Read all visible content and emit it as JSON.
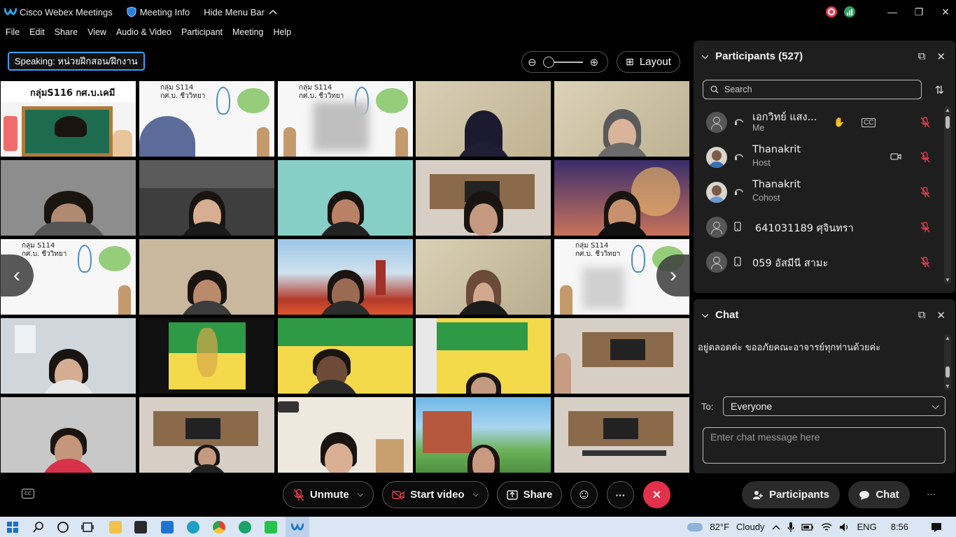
{
  "titlebar": {
    "app_name": "Cisco Webex Meetings",
    "meeting_info": "Meeting Info",
    "hide_menu": "Hide Menu Bar",
    "chevron_up": "^",
    "minimize": "—",
    "restore": "❐",
    "close": "✕"
  },
  "menu": {
    "items": [
      "File",
      "Edit",
      "Share",
      "View",
      "Audio & Video",
      "Participant",
      "Meeting",
      "Help"
    ]
  },
  "toolbar": {
    "speaking": "Speaking: หน่วยฝึกสอน/ฝึกงาน",
    "zoom_out": "⊖",
    "zoom_in": "⊕",
    "zoom_level": 0.05,
    "layout_icon": "⊞",
    "layout_label": "Layout"
  },
  "grid": {
    "tile1_title": "กลุ่มS116 กศ.บ.เคมี",
    "tile_s114_title": "กลุ่ม S114",
    "tile_s114_sub": "กศ.บ. ชีววิทยา",
    "prev_arrow": "‹",
    "next_arrow": "›"
  },
  "participants": {
    "chevron": "⌵",
    "title": "Participants (527)",
    "popout_icon": "⧉",
    "close_icon": "✕",
    "search_placeholder": "Search",
    "sort_icon": "⇅",
    "rows": [
      {
        "name": "เอกวิทย์ แสง...",
        "role": "Me"
      },
      {
        "name": "Thanakrit",
        "role": "Host"
      },
      {
        "name": "Thanakrit",
        "role": "Cohost"
      },
      {
        "name": "641031189 ศุจินทรา",
        "role": ""
      },
      {
        "name": "059 อัสมีนี สามะ",
        "role": ""
      }
    ]
  },
  "chat": {
    "chevron": "⌵",
    "title": "Chat",
    "popout_icon": "⧉",
    "close_icon": "✕",
    "message": "อยู่ตลอดค่ะ ขออภัยคณะอาจารย์ทุกท่านด้วยค่ะ",
    "to_label": "To:",
    "to_value": "Everyone",
    "dropdown": "⌵",
    "input_placeholder": "Enter chat message here"
  },
  "controls": {
    "cc": "CC",
    "unmute": "Unmute",
    "start_video": "Start video",
    "share": "Share",
    "reactions": "☺",
    "more": "···",
    "leave": "✕",
    "participants": "Participants",
    "chat": "Chat",
    "overflow": "···",
    "caret": "⌵"
  },
  "taskbar": {
    "temperature": "82°F",
    "weather": "Cloudy",
    "language": "ENG",
    "time": "8:56"
  },
  "colors": {
    "accent_blue": "#3aa0ff",
    "leave_red": "#e2314a",
    "muted_red": "#e3394f",
    "panel_bg": "#1e1e1e"
  }
}
